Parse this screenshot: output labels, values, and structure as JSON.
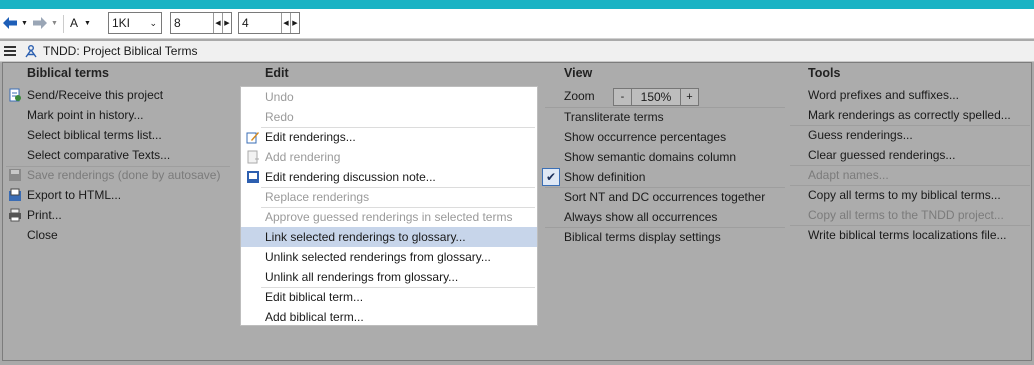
{
  "toolbar": {
    "font_label": "A",
    "book": "1KI",
    "chapter": "8",
    "verse": "4"
  },
  "window": {
    "title": "TNDD: Project Biblical Terms"
  },
  "menu": {
    "biblical_terms": {
      "header": "Biblical terms",
      "items": [
        "Send/Receive this project",
        "Mark point in history...",
        "Select biblical terms list...",
        "Select comparative Texts...",
        "Save renderings (done by autosave)",
        "Export to HTML...",
        "Print...",
        "Close"
      ]
    },
    "edit": {
      "header": "Edit",
      "items": [
        "Undo",
        "Redo",
        "Edit renderings...",
        "Add rendering",
        "Edit rendering discussion note...",
        "Replace renderings",
        "Approve guessed renderings in selected terms",
        "Link selected renderings to glossary...",
        "Unlink selected renderings from glossary...",
        "Unlink all renderings from glossary...",
        "Edit biblical term...",
        "Add biblical term..."
      ]
    },
    "view": {
      "header": "View",
      "zoom_label": "Zoom",
      "zoom_minus": "-",
      "zoom_value": "150%",
      "zoom_plus": "+",
      "items": [
        "Transliterate terms",
        "Show occurrence percentages",
        "Show semantic domains column",
        "Show definition",
        "Sort NT and DC occurrences together",
        "Always show all occurrences",
        "Biblical terms display settings"
      ]
    },
    "tools": {
      "header": "Tools",
      "items": [
        "Word prefixes and suffixes...",
        "Mark renderings as correctly spelled...",
        "Guess renderings...",
        "Clear guessed renderings...",
        "Adapt names...",
        "Copy all terms to my biblical terms...",
        "Copy all terms to the TNDD project...",
        "Write biblical terms localizations file..."
      ]
    }
  },
  "colors": {
    "accent": "#1ab3c4",
    "highlight": "#c7d5ea",
    "panel": "#acacac"
  }
}
